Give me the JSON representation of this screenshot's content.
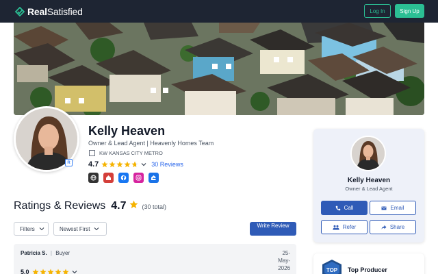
{
  "header": {
    "brand_bold": "Real",
    "brand_rest": "Satisfied",
    "login_label": "Log In",
    "signup_label": "Sign Up"
  },
  "profile": {
    "name": "Kelly Heaven",
    "subtitle": "Owner & Lead Agent | Heavenly Homes Team",
    "brokerage": "KW KANSAS CITY METRO",
    "rating": "4.7",
    "rating_fraction": 0.94,
    "reviews_link": "30 Reviews",
    "socials": [
      {
        "icon": "globe-icon",
        "color": "#333333"
      },
      {
        "icon": "home-icon",
        "color": "#d43f3a"
      },
      {
        "icon": "facebook-icon",
        "color": "#1877f2"
      },
      {
        "icon": "instagram-icon",
        "color": "#d6249f"
      },
      {
        "icon": "zillow-icon",
        "color": "#1a73e8"
      }
    ]
  },
  "ratings_section": {
    "title": "Ratings & Reviews",
    "score": "4.7",
    "total": "(30 total)",
    "filters_label": "Filters",
    "sort_label": "Newest First",
    "write_review_label": "Write Review"
  },
  "reviews": [
    {
      "reviewer": "Patricia S.",
      "separator": "|",
      "role": "Buyer",
      "date": "25-May-2026",
      "rating": "5.0"
    }
  ],
  "side_card": {
    "name": "Kelly Heaven",
    "role": "Owner & Lead Agent",
    "call_label": "Call",
    "email_label": "Email",
    "refer_label": "Refer",
    "share_label": "Share"
  },
  "producer_card": {
    "badge_text": "TOP",
    "label": "Top Producer"
  },
  "colors": {
    "brand_green": "#2bbf94",
    "primary_blue": "#2f5bb7",
    "star_gold": "#f5b301",
    "header_bg": "#1e2533"
  }
}
